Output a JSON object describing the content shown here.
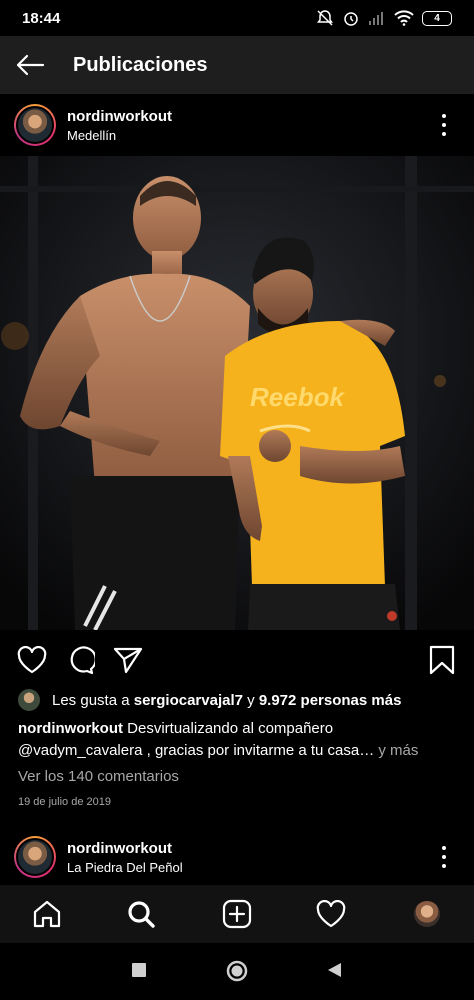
{
  "status_bar": {
    "time": "18:44",
    "battery": "4"
  },
  "header": {
    "title": "Publicaciones"
  },
  "post": {
    "username": "nordinworkout",
    "location": "Medellín",
    "likes_prefix": "Les gusta a",
    "liked_by": "sergiocarvajal7",
    "likes_connector": "y",
    "likes_others": "9.972 personas más",
    "caption_user": "nordinworkout",
    "caption_text_line1": "Desvirtualizando al compañero",
    "caption_mention": "@vadym_cavalera",
    "caption_text_line2": ", gracias por invitarme a tu casa…",
    "caption_more": "y más",
    "comments_link": "Ver los 140 comentarios",
    "date": "19 de julio de 2019",
    "image_brand_text": "Reebok"
  },
  "next_post": {
    "username": "nordinworkout",
    "location": "La Piedra Del Peñol"
  },
  "icons": {
    "back": "arrow-left-icon",
    "more": "more-vertical-icon",
    "like": "heart-icon",
    "comment": "comment-icon",
    "share": "send-icon",
    "save": "bookmark-icon",
    "home": "home-icon",
    "search": "search-icon",
    "new_post": "add-post-icon",
    "activity": "heart-icon"
  },
  "colors": {
    "background": "#000000",
    "header": "#1e1e1e",
    "muted": "#a8a8a8",
    "shirt": "#f5b21c"
  }
}
